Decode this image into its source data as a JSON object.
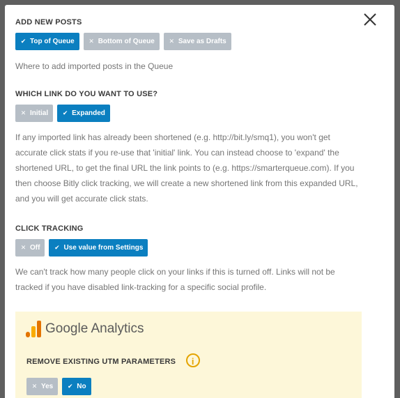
{
  "modal": {
    "close_icon": "close-icon",
    "add_new_posts": {
      "heading": "ADD NEW POSTS",
      "options": [
        {
          "label": "Top of Queue",
          "selected": true
        },
        {
          "label": "Bottom of Queue",
          "selected": false
        },
        {
          "label": "Save as Drafts",
          "selected": false
        }
      ],
      "description": "Where to add imported posts in the Queue"
    },
    "link_choice": {
      "heading": "WHICH LINK DO YOU WANT TO USE?",
      "options": [
        {
          "label": "Initial",
          "selected": false
        },
        {
          "label": "Expanded",
          "selected": true
        }
      ],
      "description": "If any imported link has already been shortened (e.g. http://bit.ly/smq1), you won't get accurate click stats if you re-use that 'initial' link. You can instead choose to 'expand' the shortened URL, to get the final URL the link points to (e.g. https://smarterqueue.com). If you then choose Bitly click tracking, we will create a new shortened link from this expanded URL, and you will get accurate click stats."
    },
    "click_tracking": {
      "heading": "CLICK TRACKING",
      "options": [
        {
          "label": "Off",
          "selected": false
        },
        {
          "label": "Use value from Settings",
          "selected": true
        }
      ],
      "description": "We can't track how many people click on your links if this is turned off. Links will not be tracked if you have disabled link-tracking for a specific social profile."
    },
    "google_analytics": {
      "logo_text": "Google Analytics",
      "heading": "REMOVE EXISTING UTM PARAMETERS",
      "info_icon": "info-icon",
      "options": [
        {
          "label": "Yes",
          "selected": false
        },
        {
          "label": "No",
          "selected": true
        }
      ]
    }
  },
  "colors": {
    "selected": "#0b7fc0",
    "unselected": "#b6bec6",
    "ga_background": "#fdf7d9",
    "info_accent": "#e4a400"
  }
}
